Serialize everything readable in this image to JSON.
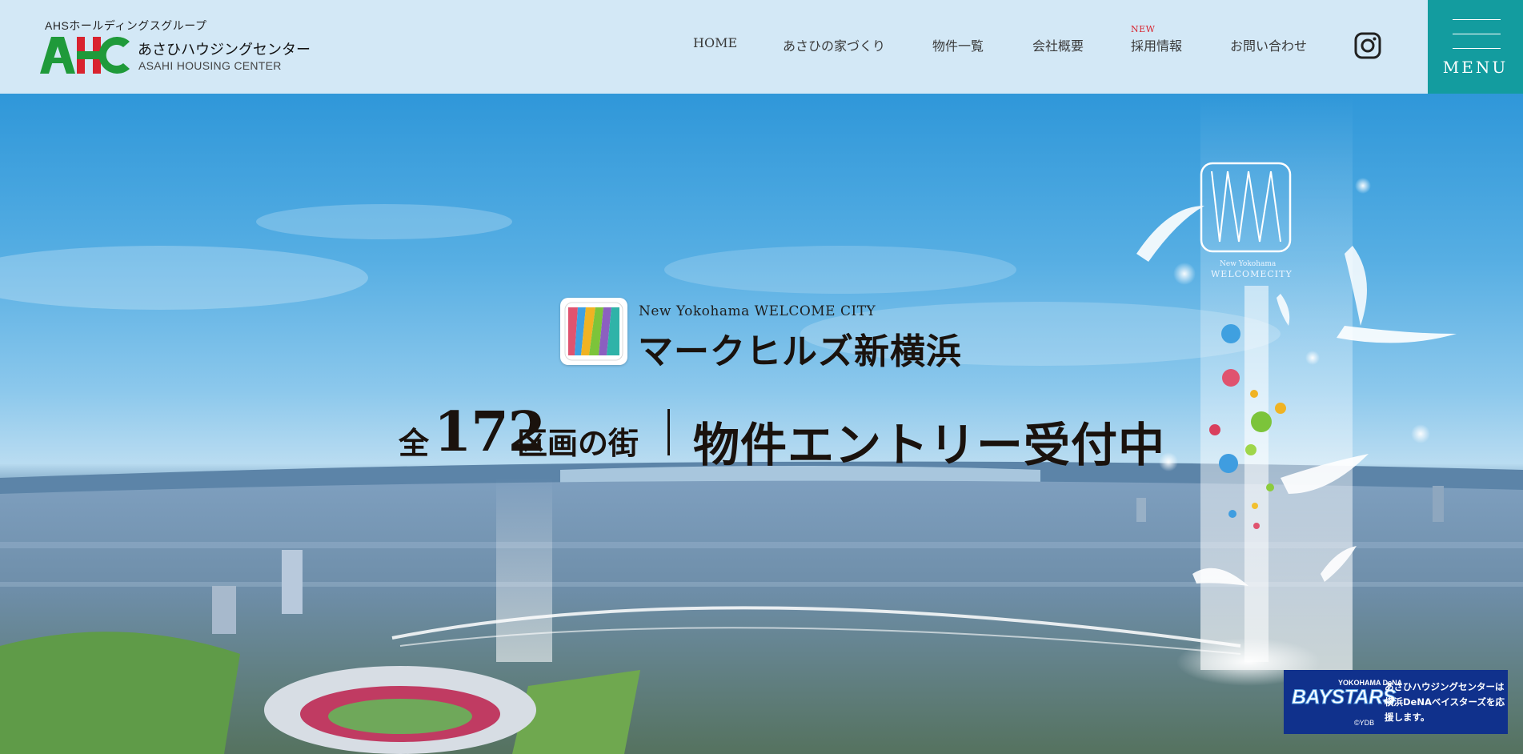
{
  "header": {
    "logo": {
      "group_label": "AHSホールディングスグループ",
      "mark_text": "AHC",
      "name_ja": "あさひハウジングセンター",
      "name_en": "ASAHI HOUSING CENTER",
      "colors": {
        "green": "#1f9a3a",
        "red": "#d9232f"
      }
    },
    "nav": [
      {
        "label": "HOME"
      },
      {
        "label": "あさひの家づくり"
      },
      {
        "label": "物件一覧"
      },
      {
        "label": "会社概要"
      },
      {
        "label": "採用情報",
        "badge": "NEW"
      },
      {
        "label": "お問い合わせ"
      }
    ],
    "instagram_icon": "instagram-icon",
    "menu": {
      "label": "MENU",
      "color": "#139c9f"
    }
  },
  "hero": {
    "project": {
      "subtitle": "New Yokohama WELCOME CITY",
      "title": "マークヒルズ新横浜"
    },
    "tagline": {
      "prefix": "全",
      "number": "172",
      "suffix": "区画の街",
      "message": "物件エントリー受付中"
    },
    "tower_logo": {
      "line1": "New Yokohama",
      "line2": "WELCOMECITY"
    },
    "banner": {
      "team": "BAYSTARS",
      "team_small": "YOKOHAMA DeNA",
      "copyright": "©YDB",
      "text": "あさひハウジングセンターは横浜DeNAベイスターズを応援します。",
      "color": "#10318c"
    }
  }
}
